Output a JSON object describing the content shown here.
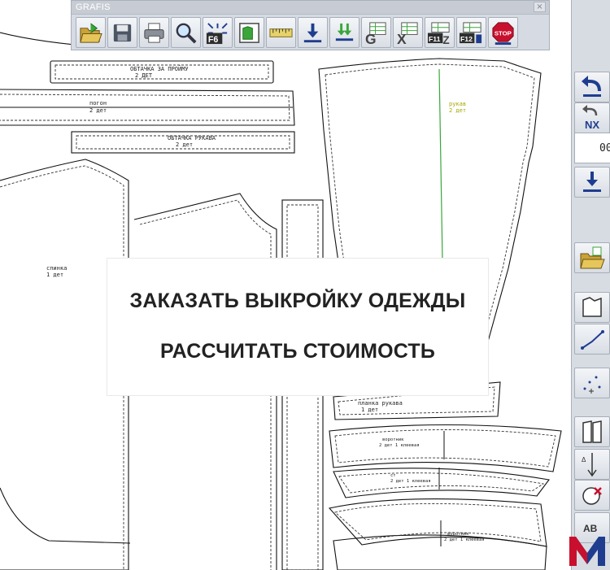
{
  "window": {
    "title": "GRAFIS",
    "close_glyph": "×"
  },
  "toolbar": {
    "buttons": [
      {
        "icon": "open-folder-icon"
      },
      {
        "icon": "save-disk-icon"
      },
      {
        "icon": "printer-icon"
      },
      {
        "icon": "magnifier-icon"
      },
      {
        "icon": "f6-fullscreen-icon",
        "label": "F6"
      },
      {
        "icon": "page-layout-icon"
      },
      {
        "icon": "measuring-tape-icon"
      },
      {
        "icon": "download-arrow-icon"
      },
      {
        "icon": "download-multi-icon"
      },
      {
        "icon": "table-g-icon",
        "label": "G"
      },
      {
        "icon": "table-x-icon",
        "label": "X"
      },
      {
        "icon": "f11-z-icon",
        "label": "F11",
        "label2": "Z"
      },
      {
        "icon": "f12-icon",
        "label": "F12"
      },
      {
        "icon": "stop-icon",
        "label": "STOP"
      }
    ]
  },
  "side_toolbar": {
    "value": "00",
    "nx_label": "NX",
    "icons": [
      "undo-icon",
      "redo-nx-icon",
      "download-arrow-icon",
      "open-folder-icon",
      "shape-outline-icon",
      "line-points-icon",
      "scatter-points-icon",
      "piece-edit-icon",
      "grainline-icon",
      "circle-cut-icon",
      "text-abc-icon"
    ],
    "abc_label": "AB"
  },
  "pattern_labels": [
    {
      "name": "ОБТАЧКА ЗА ПРОЙМУ",
      "qty": "2 ДЕТ"
    },
    {
      "name": "погон",
      "qty": "2 дет"
    },
    {
      "name": "ОБТАЧКА РУКАВА",
      "qty": "2 дет"
    },
    {
      "name": "спинка",
      "qty": "1 дет"
    },
    {
      "name": "рукав",
      "qty": "2 дет"
    },
    {
      "name": "планка рукава",
      "qty": "1 дет"
    },
    {
      "name": "воротник",
      "qty": "2 дет 1 клеевая"
    },
    {
      "name": "ст",
      "qty": "2 дет 1 клеевая"
    },
    {
      "name": "воротник",
      "qty": "2 дет 1 клеевая"
    }
  ],
  "promo": {
    "line1": "ЗАКАЗАТЬ ВЫКРОЙКУ ОДЕЖДЫ",
    "line2": "РАССЧИТАТЬ СТОИМОСТЬ"
  },
  "colors": {
    "accent_red": "#c8102e",
    "accent_blue": "#1f3d8f",
    "sleeve_green": "#3aa63a",
    "label_yellow": "#a8a800"
  }
}
